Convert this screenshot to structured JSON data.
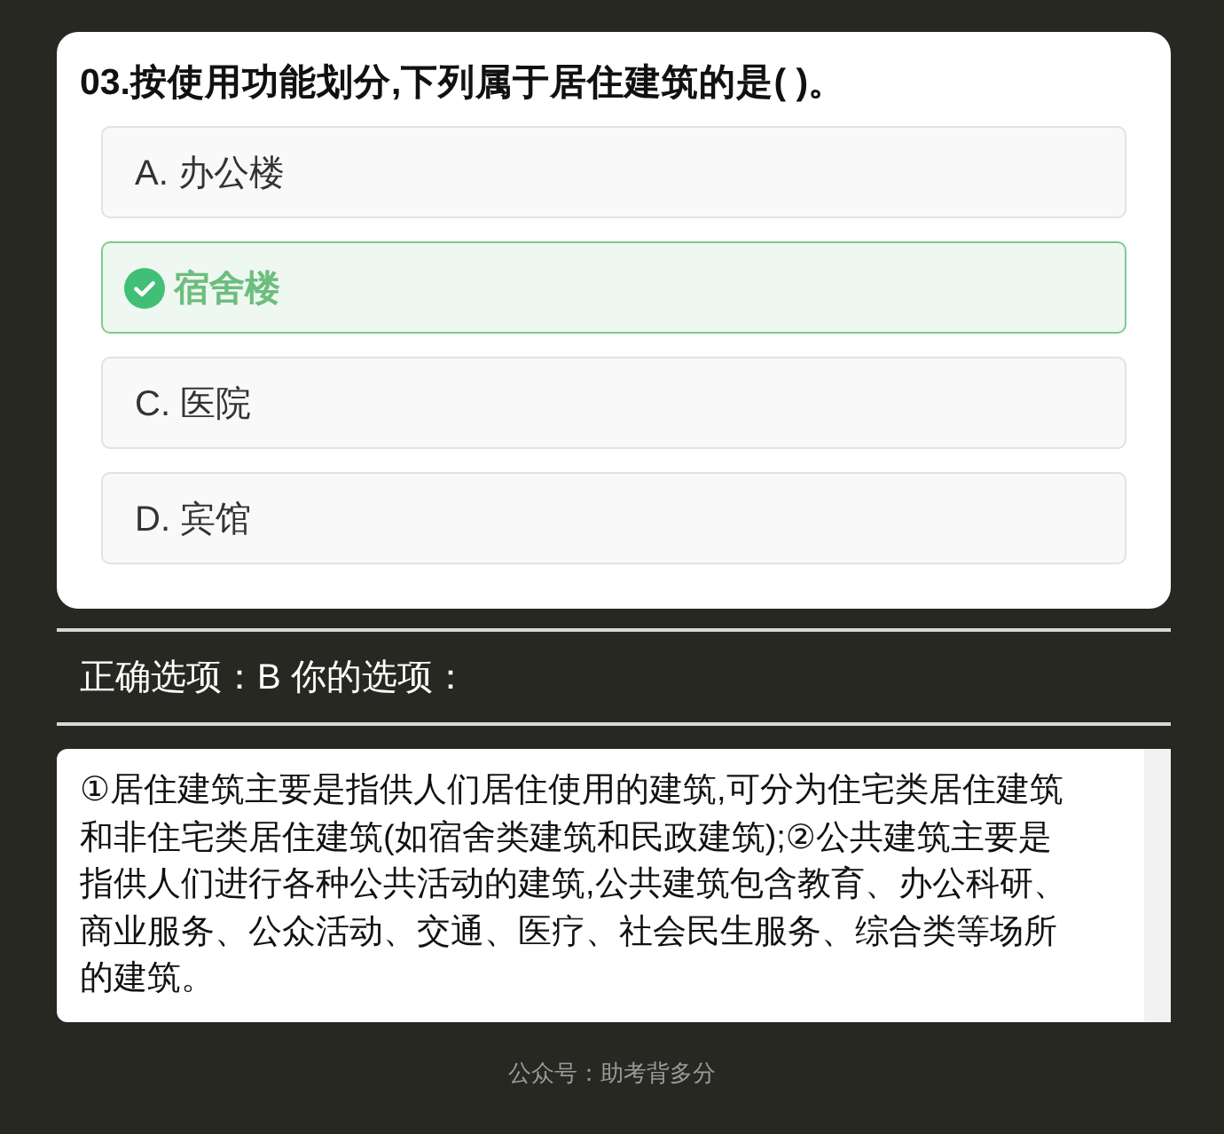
{
  "question": {
    "title": "03.按使用功能划分,下列属于居住建筑的是( )。",
    "options": [
      {
        "label": "A. 办公楼",
        "selected": false
      },
      {
        "label": "宿舍楼",
        "selected": true
      },
      {
        "label": "C. 医院",
        "selected": false
      },
      {
        "label": "D. 宾馆",
        "selected": false
      }
    ]
  },
  "answer_line": "正确选项：B 你的选项：",
  "explanation": "①居住建筑主要是指供人们居住使用的建筑,可分为住宅类居住建筑和非住宅类居住建筑(如宿舍类建筑和民政建筑);②公共建筑主要是指供人们进行各种公共活动的建筑,公共建筑包含教育、办公科研、商业服务、公众活动、交通、医疗、社会民生服务、综合类等场所的建筑。",
  "footer": "公众号：助考背多分"
}
